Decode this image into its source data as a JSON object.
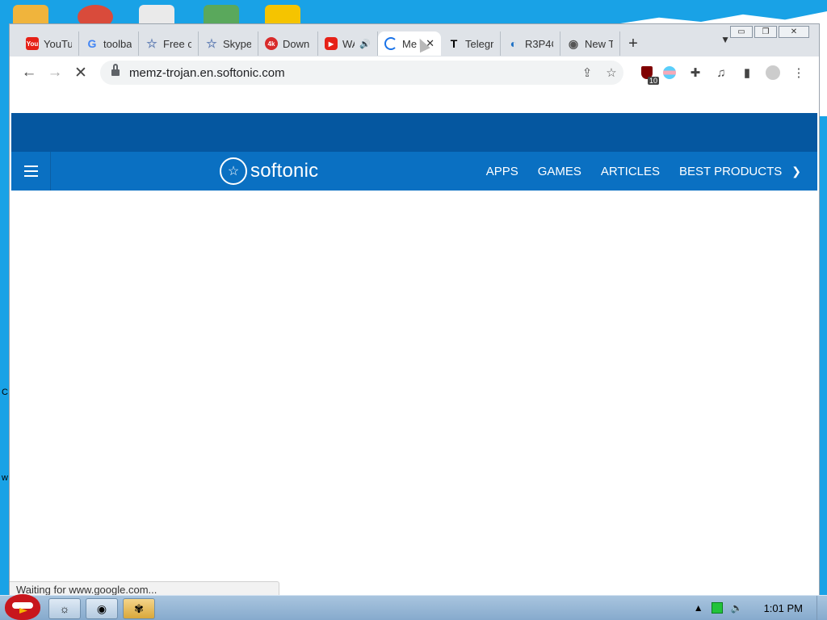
{
  "browser": {
    "tabs": [
      {
        "title": "YouTul",
        "icon": "youtube-icon",
        "audio": false,
        "active": false
      },
      {
        "title": "toolba",
        "icon": "google-icon",
        "audio": false,
        "active": false
      },
      {
        "title": "Free c",
        "icon": "star-icon",
        "audio": false,
        "active": false
      },
      {
        "title": "Skype",
        "icon": "star-icon",
        "audio": false,
        "active": false
      },
      {
        "title": "Down",
        "icon": "download-site-icon",
        "audio": false,
        "active": false
      },
      {
        "title": "WA",
        "icon": "youtube-icon",
        "audio": true,
        "active": false
      },
      {
        "title": "Me",
        "icon": "loading-icon",
        "audio": false,
        "active": true
      },
      {
        "title": "Telegr",
        "icon": "telegraph-icon",
        "audio": false,
        "active": false
      },
      {
        "title": "R3P4C",
        "icon": "edge-icon",
        "audio": false,
        "active": false
      },
      {
        "title": "New T",
        "icon": "chrome-icon",
        "audio": false,
        "active": false
      }
    ],
    "url": "memz-trojan.en.softonic.com",
    "extension_badge": "10",
    "status_text": "Waiting for www.google.com..."
  },
  "site": {
    "logo_text": "softonic",
    "menu": [
      "APPS",
      "GAMES",
      "ARTICLES",
      "BEST PRODUCTS"
    ]
  },
  "taskbar": {
    "clock": "1:01 PM"
  },
  "desktop_edge_text": {
    "c": "C",
    "w": "w"
  }
}
